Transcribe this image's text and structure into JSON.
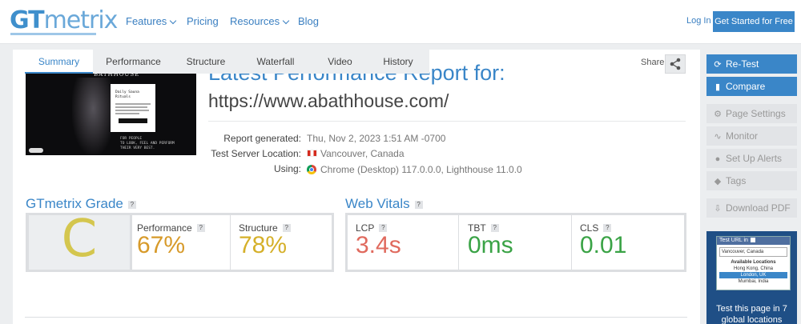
{
  "header": {
    "logo_gt": "GT",
    "logo_metrix": "metrix",
    "nav": [
      {
        "label": "Features",
        "dropdown": true
      },
      {
        "label": "Pricing",
        "dropdown": false
      },
      {
        "label": "Resources",
        "dropdown": true
      },
      {
        "label": "Blog",
        "dropdown": false
      }
    ],
    "login": "Log In",
    "get_started": "Get Started for Free"
  },
  "report": {
    "title": "Latest Performance Report for:",
    "url": "https://www.abathhouse.com/",
    "share": "Share",
    "meta": {
      "generated_label": "Report generated:",
      "generated_value": "Thu, Nov 2, 2023 1:51 AM -0700",
      "server_label": "Test Server Location:",
      "server_value": "Vancouver, Canada",
      "using_label": "Using:",
      "using_value": "Chrome (Desktop) 117.0.0.0, Lighthouse 11.0.0"
    }
  },
  "screenshot": {
    "brand": "BATHHOUSE",
    "popup_text": "Daily Sauna\nRituals",
    "tagline": "FOR PEOPLE\nTO LOOK, FEEL AND PERFORM\nTHEIR VERY BEST."
  },
  "grade": {
    "heading": "GTmetrix Grade",
    "help": "?",
    "letter": "C",
    "performance_label": "Performance",
    "performance_value": "67%",
    "structure_label": "Structure",
    "structure_value": "78%"
  },
  "vitals": {
    "heading": "Web Vitals",
    "help": "?",
    "lcp_label": "LCP",
    "lcp_value": "3.4s",
    "tbt_label": "TBT",
    "tbt_value": "0ms",
    "cls_label": "CLS",
    "cls_value": "0.01"
  },
  "tabs": [
    "Summary",
    "Performance",
    "Structure",
    "Waterfall",
    "Video",
    "History"
  ],
  "active_tab": "Summary",
  "sidebar": {
    "retest": "Re-Test",
    "compare": "Compare",
    "page_settings": "Page Settings",
    "monitor": "Monitor",
    "setup_alerts": "Set Up Alerts",
    "tags": "Tags",
    "download_pdf": "Download PDF"
  },
  "promo": {
    "box_title": "Test URL in",
    "selected": "Vancouver, Canada",
    "available": "Available Locations",
    "options": [
      "Hong Kong, China",
      "London, UK",
      "Mumbai, India"
    ],
    "text": "Test this page in 7 global locations"
  },
  "colors": {
    "brand_blue": "#3a86c8",
    "grade_c": "#d4c64e",
    "perf_value": "#d79a2a",
    "struct_value": "#d5b02a",
    "lcp_value": "#e06a5e",
    "good_green": "#3aa346"
  }
}
